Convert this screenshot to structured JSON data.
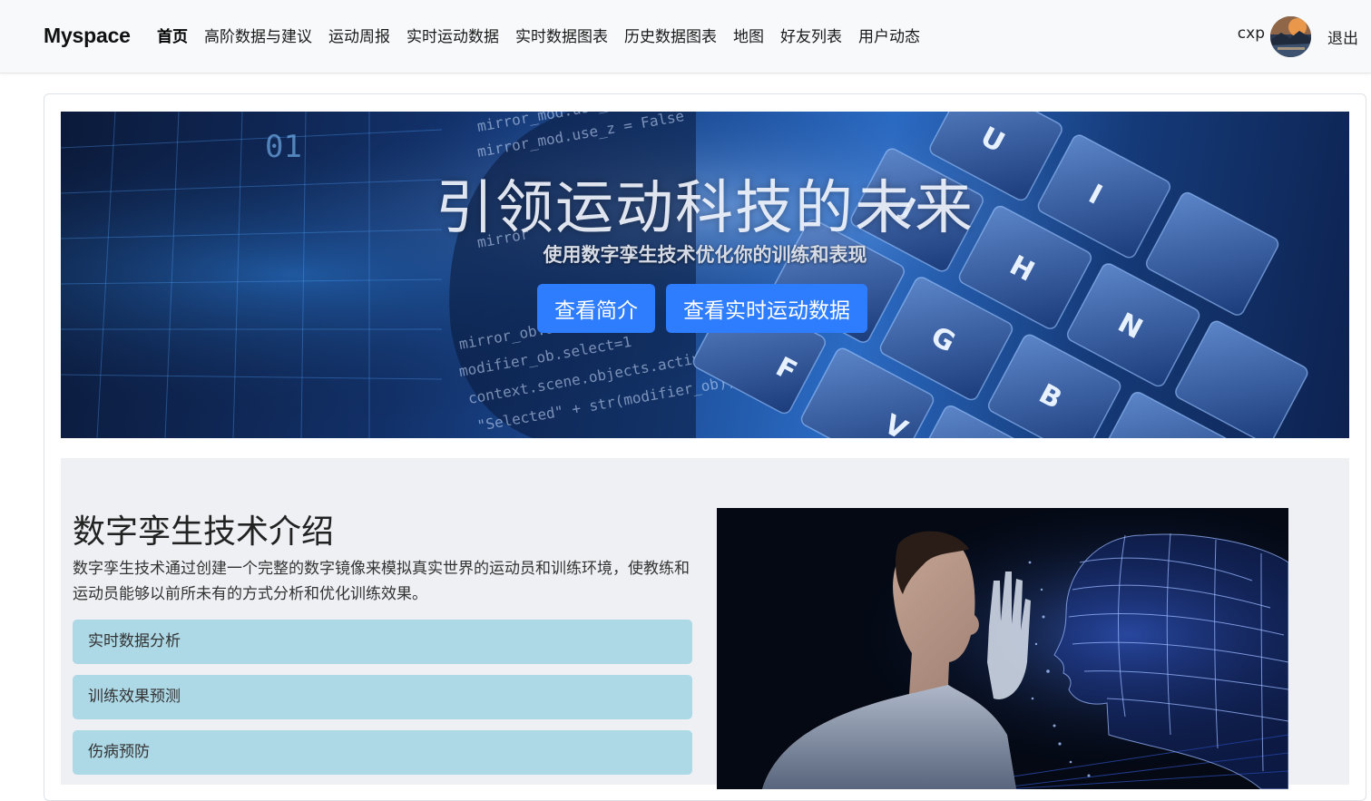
{
  "navbar": {
    "brand": "Myspace",
    "links": [
      {
        "label": "首页",
        "active": true
      },
      {
        "label": "高阶数据与建议",
        "active": false
      },
      {
        "label": "运动周报",
        "active": false
      },
      {
        "label": "实时运动数据",
        "active": false
      },
      {
        "label": "实时数据图表",
        "active": false
      },
      {
        "label": "历史数据图表",
        "active": false
      },
      {
        "label": "地图",
        "active": false
      },
      {
        "label": "好友列表",
        "active": false
      },
      {
        "label": "用户动态",
        "active": false
      }
    ],
    "username": "cxp",
    "logout_label": "退出"
  },
  "hero": {
    "title": "引领运动科技的未来",
    "subtitle": "使用数字孪生技术优化你的训练和表现",
    "buttons": [
      "查看简介",
      "查看实时运动数据"
    ]
  },
  "intro": {
    "title": "数字孪生技术介绍",
    "description": "数字孪生技术通过创建一个完整的数字镜像来模拟真实世界的运动员和训练环境，使教练和运动员能够以前所未有的方式分析和优化训练效果。",
    "features": [
      "实时数据分析",
      "训练效果预测",
      "伤病预防"
    ]
  },
  "colors": {
    "primary_button": "#2f7dff",
    "feature_bg": "#add8e6",
    "navbar_bg": "#f8f9fa",
    "intro_bg": "#eef0f4"
  }
}
